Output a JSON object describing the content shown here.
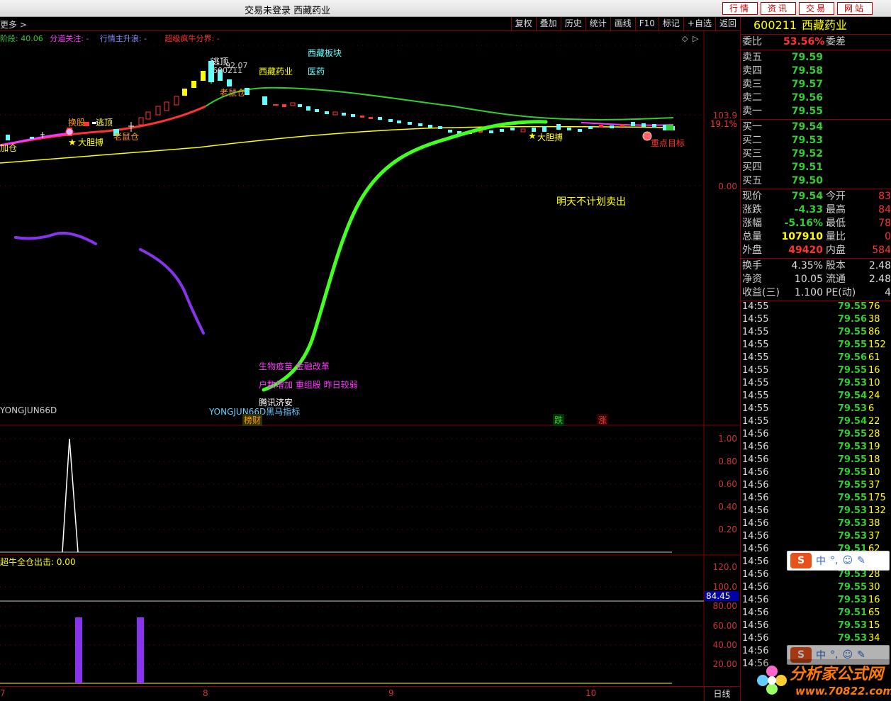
{
  "window": {
    "title": "交易未登录  西藏药业"
  },
  "title_buttons": [
    "行情",
    "资讯",
    "交易",
    "网站"
  ],
  "toolbar": {
    "more": "更多 >",
    "tools": [
      "复权",
      "叠加",
      "历史",
      "统计",
      "画线",
      "F10",
      "标记",
      "+自选",
      "返回"
    ]
  },
  "indicator_header": {
    "a": "阶段: 40.06",
    "b": "分道关注: -",
    "c": "行情主升浪: -",
    "d": "超级疯牛分界: -"
  },
  "chart_labels": {
    "escape_top": "逃顶",
    "high_price": "92.07",
    "code_tag": "600211",
    "stock_name": "西藏药业",
    "sector": "西藏板块",
    "industry": "医药",
    "old_rat": "老鼠仓",
    "escape_top2": "逃顶",
    "swap_stock": "换股",
    "old_rat2": "老鼠仓",
    "bold_bet": "大胆搏",
    "add_pos": "加仓",
    "bold_bet2": "大胆搏",
    "key_target": "重点目标",
    "note": "明天不计划卖出",
    "concept1": "生物疫苗 金融改革",
    "concept2": "户数增加 重组股 昨日较弱",
    "concept3": "腾讯济安",
    "signature_left": "YONGJUN66D",
    "signature_mid": "YONGJUN66D黑马指标",
    "tag_list": "榜财",
    "tag_fall": "跌",
    "tag_rise": "涨",
    "price_right": "103.9",
    "pct_right": "19.1%",
    "zero": "0.00",
    "sub2_title": "超牛全仓出击: 0.00",
    "sub2_value": "84.45"
  },
  "axis_sub1": [
    "1.00",
    "0.80",
    "0.60",
    "0.40",
    "0.20"
  ],
  "axis_sub2": [
    "120.0",
    "100.0",
    "80.00",
    "60.00",
    "40.00",
    "20.00"
  ],
  "x_ticks": [
    "7",
    "8",
    "9",
    "10"
  ],
  "right_panel": {
    "code": "600211",
    "name": "西藏药业",
    "weibi_label": "委比",
    "weibi": "53.56%",
    "weicha_label": "委差",
    "asks": [
      {
        "label": "卖五",
        "price": "79.59"
      },
      {
        "label": "卖四",
        "price": "79.58"
      },
      {
        "label": "卖三",
        "price": "79.57"
      },
      {
        "label": "卖二",
        "price": "79.56"
      },
      {
        "label": "卖一",
        "price": "79.55"
      }
    ],
    "bids": [
      {
        "label": "买一",
        "price": "79.54"
      },
      {
        "label": "买二",
        "price": "79.53"
      },
      {
        "label": "买三",
        "price": "79.52"
      },
      {
        "label": "买四",
        "price": "79.51"
      },
      {
        "label": "买五",
        "price": "79.50"
      }
    ],
    "stats": [
      {
        "l1": "现价",
        "v1": "79.54",
        "c1": "#3c3",
        "l2": "今开",
        "v2": "83"
      },
      {
        "l1": "涨跌",
        "v1": "-4.33",
        "c1": "#3c3",
        "l2": "最高",
        "v2": "84"
      },
      {
        "l1": "涨幅",
        "v1": "-5.16%",
        "c1": "#3c3",
        "l2": "最低",
        "v2": "78"
      },
      {
        "l1": "总量",
        "v1": "107910",
        "c1": "#ff0",
        "l2": "量比",
        "v2": "0"
      },
      {
        "l1": "外盘",
        "v1": "49420",
        "c1": "#f33",
        "l2": "内盘",
        "v2": "584"
      }
    ],
    "stats2": [
      {
        "l1": "换手",
        "v1": "4.35%",
        "l2": "股本",
        "v2": "2.48"
      },
      {
        "l1": "净资",
        "v1": "10.05",
        "l2": "流通",
        "v2": "2.48"
      },
      {
        "l1": "收益(三)",
        "v1": "1.100",
        "l2": "PE(动)",
        "v2": "4"
      }
    ],
    "ticks": [
      {
        "t": "14:55",
        "p": "79.55",
        "v": "76"
      },
      {
        "t": "14:55",
        "p": "79.56",
        "v": "38"
      },
      {
        "t": "14:55",
        "p": "79.55",
        "v": "86"
      },
      {
        "t": "14:55",
        "p": "79.55",
        "v": "152"
      },
      {
        "t": "14:55",
        "p": "79.56",
        "v": "61"
      },
      {
        "t": "14:55",
        "p": "79.55",
        "v": "16"
      },
      {
        "t": "14:55",
        "p": "79.53",
        "v": "10"
      },
      {
        "t": "14:55",
        "p": "79.54",
        "v": "24"
      },
      {
        "t": "14:55",
        "p": "79.53",
        "v": "6"
      },
      {
        "t": "14:55",
        "p": "79.54",
        "v": "22"
      },
      {
        "t": "14:56",
        "p": "79.55",
        "v": "28"
      },
      {
        "t": "14:56",
        "p": "79.53",
        "v": "19"
      },
      {
        "t": "14:56",
        "p": "79.55",
        "v": "18"
      },
      {
        "t": "14:56",
        "p": "79.55",
        "v": "10"
      },
      {
        "t": "14:56",
        "p": "79.55",
        "v": "37"
      },
      {
        "t": "14:56",
        "p": "79.55",
        "v": "175"
      },
      {
        "t": "14:56",
        "p": "79.53",
        "v": "132"
      },
      {
        "t": "14:56",
        "p": "79.53",
        "v": "38"
      },
      {
        "t": "14:56",
        "p": "79.53",
        "v": "37"
      },
      {
        "t": "14:56",
        "p": "79.51",
        "v": "62"
      },
      {
        "t": "14:56",
        "p": "79.51",
        "v": "88"
      },
      {
        "t": "14:56",
        "p": "79.53",
        "v": "28"
      },
      {
        "t": "14:56",
        "p": "79.55",
        "v": "30"
      },
      {
        "t": "14:56",
        "p": "79.53",
        "v": "16"
      },
      {
        "t": "14:56",
        "p": "79.51",
        "v": "65"
      },
      {
        "t": "14:56",
        "p": "79.53",
        "v": "15"
      },
      {
        "t": "14:56",
        "p": "79.53",
        "v": "34"
      },
      {
        "t": "14:56",
        "p": "",
        "v": ""
      },
      {
        "t": "14:56",
        "p": "",
        "v": ""
      }
    ]
  },
  "bottom": {
    "period": "日线"
  },
  "ime": {
    "lang": "中",
    "logo": "S"
  },
  "watermark": {
    "line1": "分析家公式网",
    "line2": "www.70822.com"
  },
  "colors": {
    "up": "#ff3333",
    "down": "#33cc33",
    "yellow": "#ffff00",
    "magenta": "#ff33ff",
    "cyan": "#66ffff",
    "green_line": "#33cc33",
    "purple": "#8833ee",
    "bright_green": "#44ff22"
  }
}
